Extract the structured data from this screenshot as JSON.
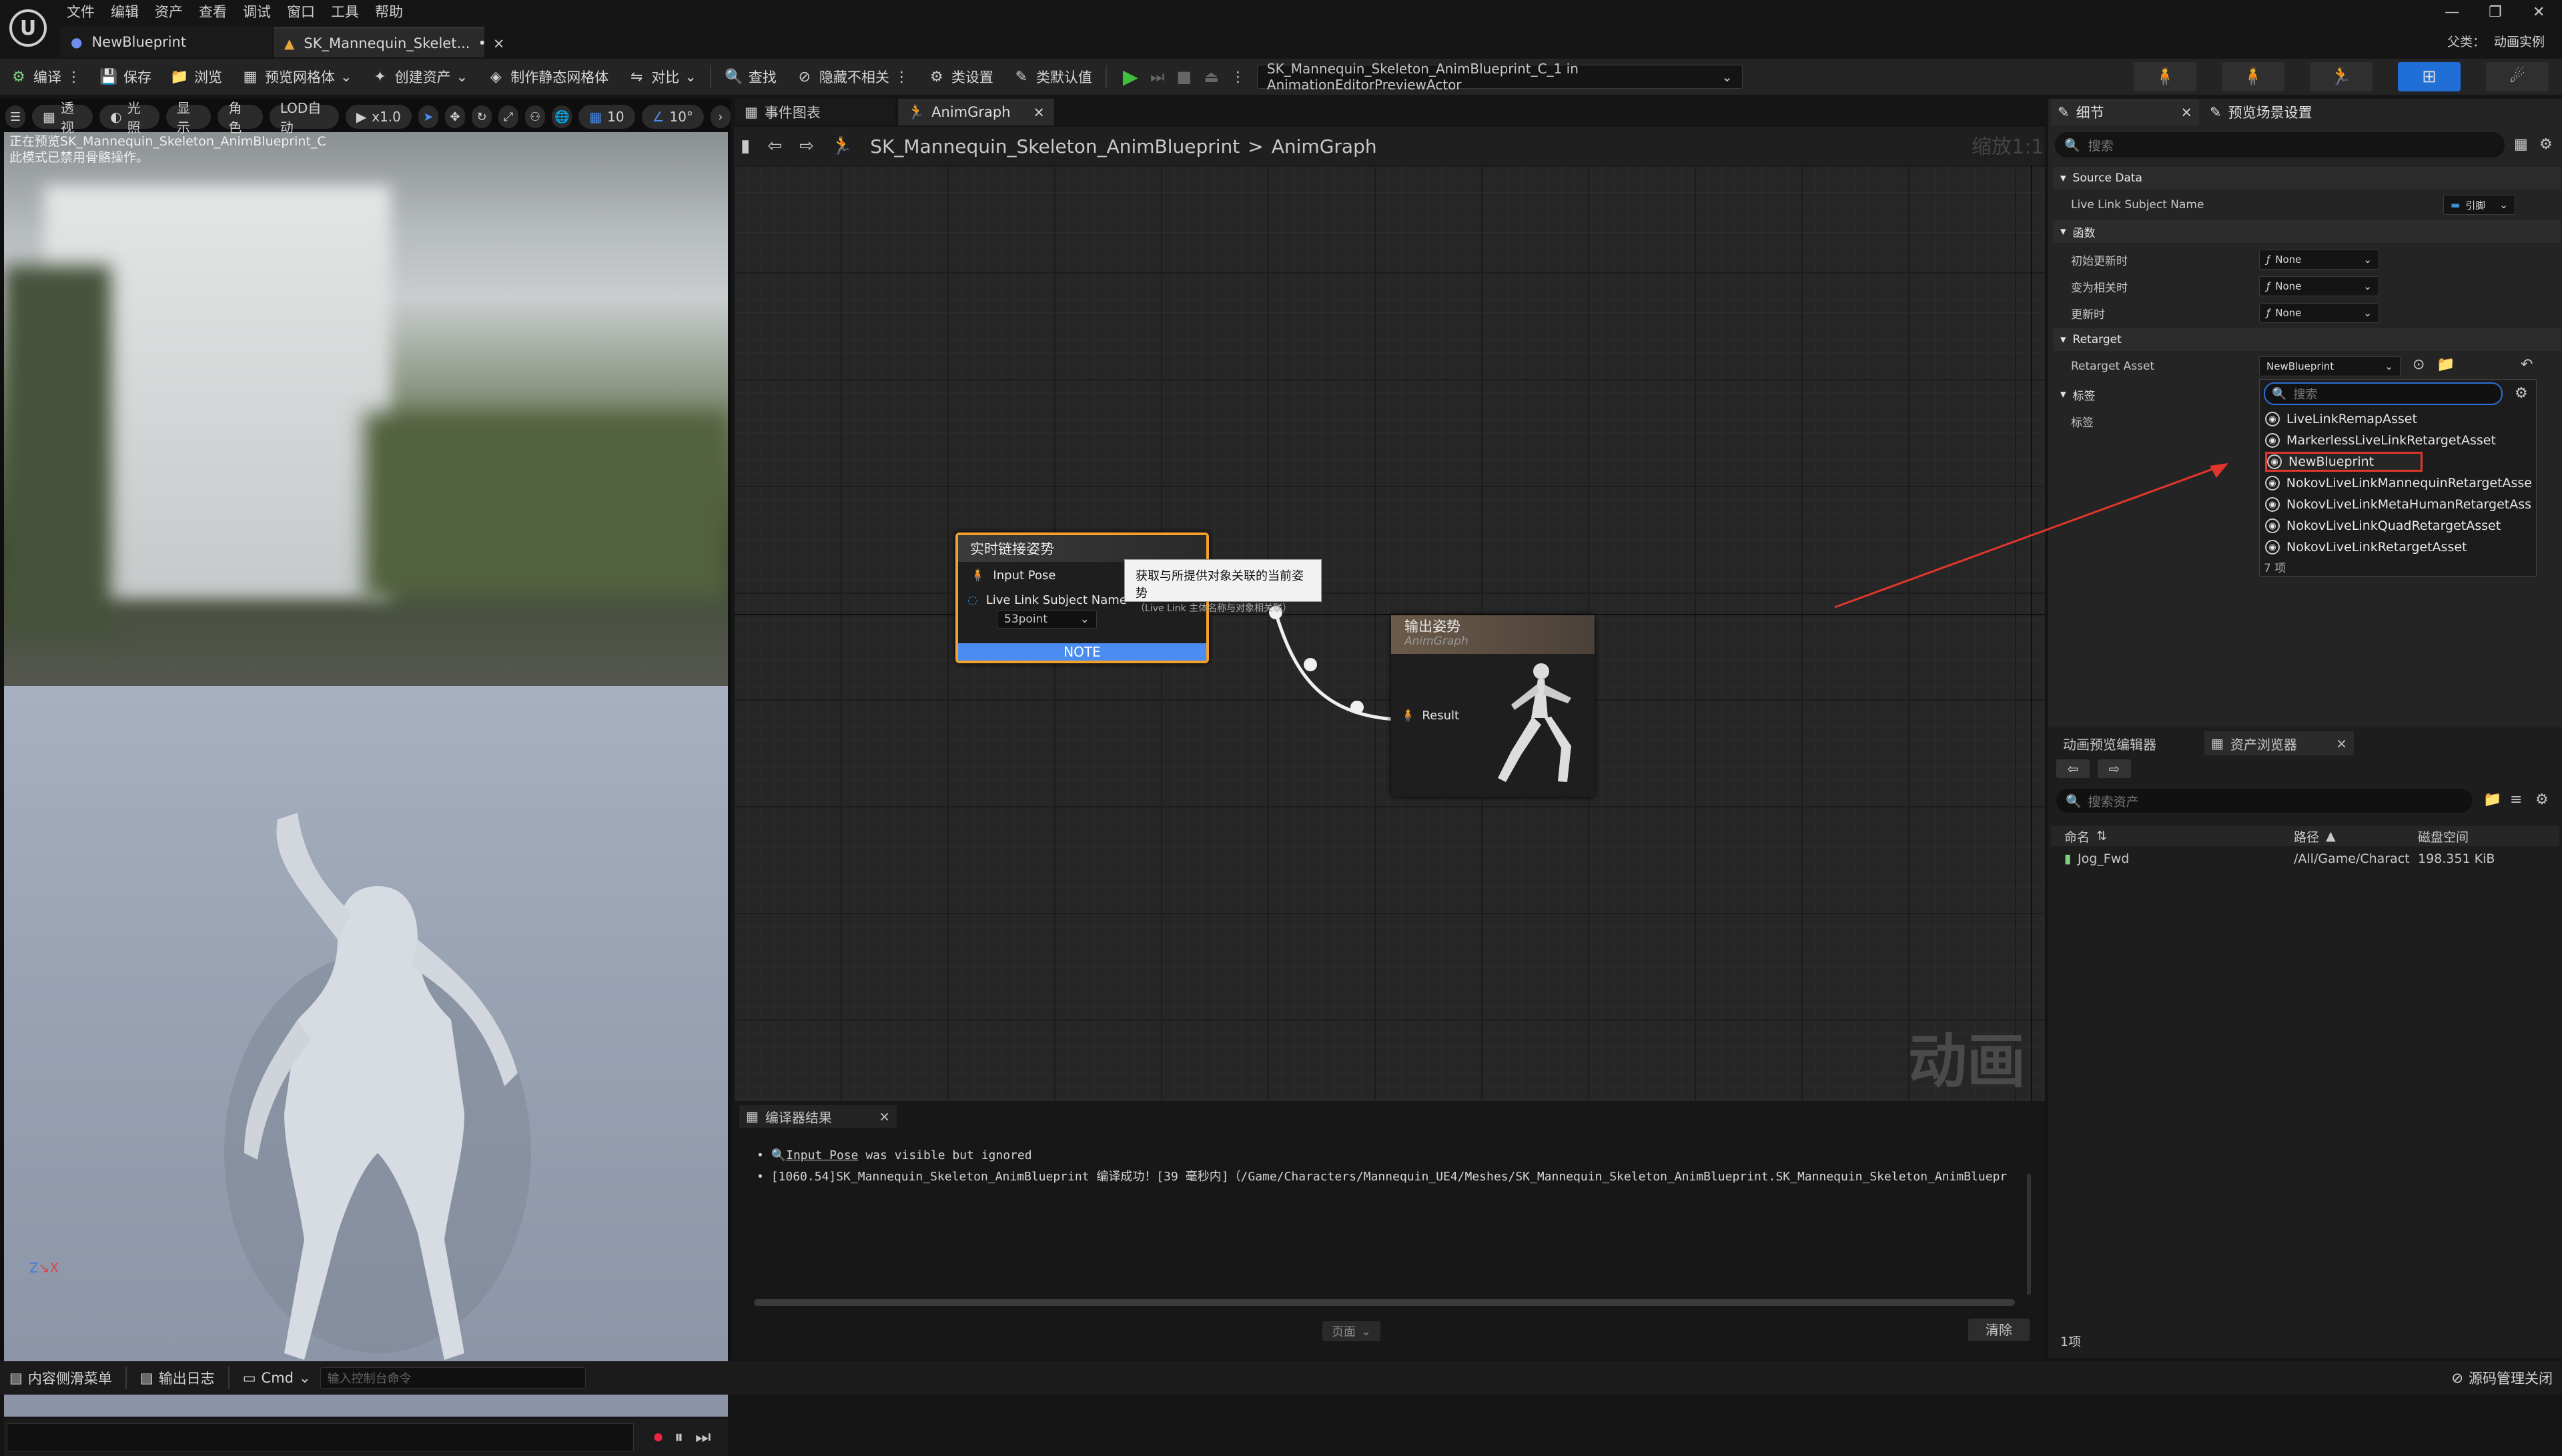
{
  "menu": [
    "文件",
    "编辑",
    "资产",
    "查看",
    "调试",
    "窗口",
    "工具",
    "帮助"
  ],
  "tabs": [
    {
      "label": "NewBlueprint"
    },
    {
      "label": "SK_Mannequin_Skelet...",
      "suffix": "•"
    }
  ],
  "title_right": {
    "parent_label": "父类：",
    "parent_value": "动画实例"
  },
  "toolbar": {
    "compile": "编译",
    "save": "保存",
    "browse": "浏览",
    "preview_mesh": "预览网格体",
    "create_asset": "创建资产",
    "make_static": "制作静态网格体",
    "diff": "对比",
    "find": "查找",
    "hide_unrelated": "隐藏不相关",
    "class_settings": "类设置",
    "class_defaults": "类默认值",
    "debug_target": "SK_Mannequin_Skeleton_AnimBlueprint_C_1 in AnimationEditorPreviewActor"
  },
  "viewport": {
    "buttons": [
      "透视",
      "光照",
      "显示",
      "角色",
      "LOD自动"
    ],
    "speed": "x1.0",
    "grid": "10",
    "angle": "10°",
    "overlay": [
      "正在预览SK_Mannequin_Skeleton_AnimBlueprint_C",
      "此模式已禁用骨骼操作。"
    ]
  },
  "graph": {
    "tabs": [
      "事件图表",
      "AnimGraph"
    ],
    "breadcrumb_root": "SK_Mannequin_Skeleton_AnimBlueprint",
    "breadcrumb_sep": ">",
    "breadcrumb_leaf": "AnimGraph",
    "zoom": "缩放1:1",
    "watermark": "动画",
    "live_node": {
      "title": "实时链接姿势",
      "pin1": "Input Pose",
      "pin2": "Live Link Subject Name",
      "value": "53point",
      "note": "NOTE"
    },
    "tooltip": {
      "line1": "获取与所提供对象关联的当前姿势",
      "line2": "（Live Link 主体名称与对象相关联）"
    },
    "output_node": {
      "title": "输出姿势",
      "subtitle": "AnimGraph",
      "pin": "Result"
    }
  },
  "compiler": {
    "tab": "编译器结果",
    "lines": [
      {
        "prefix": "Input Pose",
        "text": " was visible but ignored"
      },
      {
        "prefix": "",
        "text": "[1060.54]SK_Mannequin_Skeleton_AnimBlueprint 编译成功！[39 毫秒内]（/Game/Characters/Mannequin_UE4/Meshes/SK_Mannequin_Skeleton_AnimBlueprint.SK_Mannequin_Skeleton_AnimBluepr"
      }
    ],
    "page": "页面",
    "clear": "清除"
  },
  "details": {
    "tab1": "细节",
    "tab2": "预览场景设置",
    "search_placeholder": "搜索",
    "sections": {
      "source": "Source Data",
      "func": "函数",
      "retarget": "Retarget",
      "tags": "标签"
    },
    "props": {
      "subject": "Live Link Subject Name",
      "subject_value": "引脚",
      "init": "初始更新时",
      "init_value": "None",
      "relevant": "变为相关时",
      "relevant_value": "None",
      "update": "更新时",
      "update_value": "None",
      "retarget_asset": "Retarget Asset",
      "retarget_value": "NewBlueprint",
      "tag": "标签"
    }
  },
  "dropdown": {
    "search_placeholder": "搜索",
    "items": [
      "LiveLinkRemapAsset",
      "MarkerlessLiveLinkRetargetAsset",
      "NewBlueprint",
      "NokovLiveLinkMannequinRetargetAsse",
      "NokovLiveLinkMetaHumanRetargetAss",
      "NokovLiveLinkQuadRetargetAsset",
      "NokovLiveLinkRetargetAsset"
    ],
    "selected_index": 2,
    "count": "7 项"
  },
  "assets": {
    "tab1": "动画预览编辑器",
    "tab2": "资产浏览器",
    "search_placeholder": "搜索资产",
    "cols": [
      "命名",
      "路径",
      "磁盘空间"
    ],
    "rows": [
      {
        "name": "Jog_Fwd",
        "path": "/All/Game/Charact",
        "size": "198.351 KiB"
      }
    ],
    "footer": "1项"
  },
  "status": {
    "drawer": "内容侧滑菜单",
    "log": "输出日志",
    "cmd": "Cmd",
    "cmd_placeholder": "输入控制台命令",
    "source_control": "源码管理关闭"
  },
  "colors": {
    "accent": "#f3a12a",
    "note": "#4a8cf0",
    "highlight": "#e0362c",
    "play": "#3fbf3f"
  }
}
